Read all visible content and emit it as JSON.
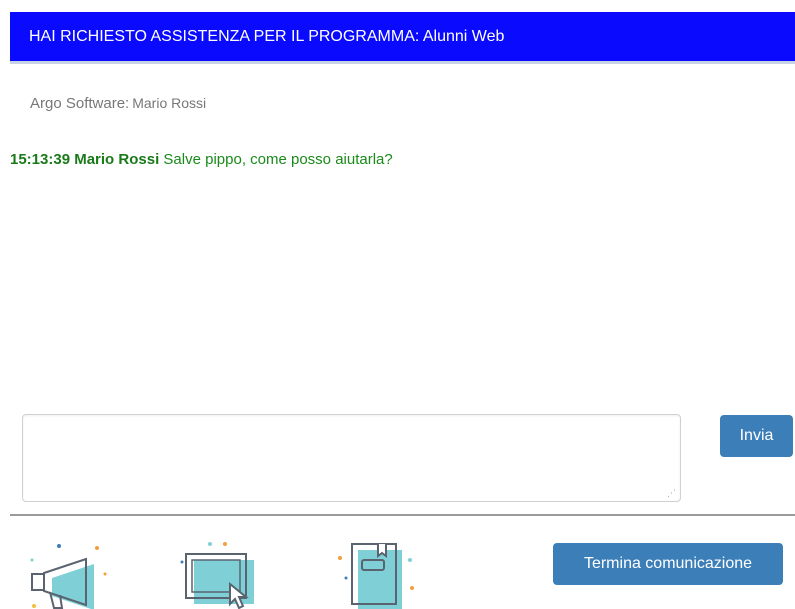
{
  "header": {
    "title": "HAI RICHIESTO ASSISTENZA PER IL PROGRAMMA: Alunni Web",
    "background": "#0a0aff"
  },
  "operator": {
    "label": "Argo Software:",
    "name": "Mario Rossi"
  },
  "chat": {
    "messages": [
      {
        "time": "15:13:39",
        "author": "Mario Rossi",
        "text": "Salve pippo, come posso aiutarla?",
        "color": "#1a8a1a"
      }
    ]
  },
  "composer": {
    "input_value": "",
    "send_label": "Invia"
  },
  "footer": {
    "end_label": "Termina comunicazione",
    "icons": [
      "megaphone-icon",
      "laptop-cursor-icon",
      "notebook-icon"
    ]
  },
  "colors": {
    "button": "#3c7eb8",
    "icon_fill": "#7fd0d6"
  }
}
